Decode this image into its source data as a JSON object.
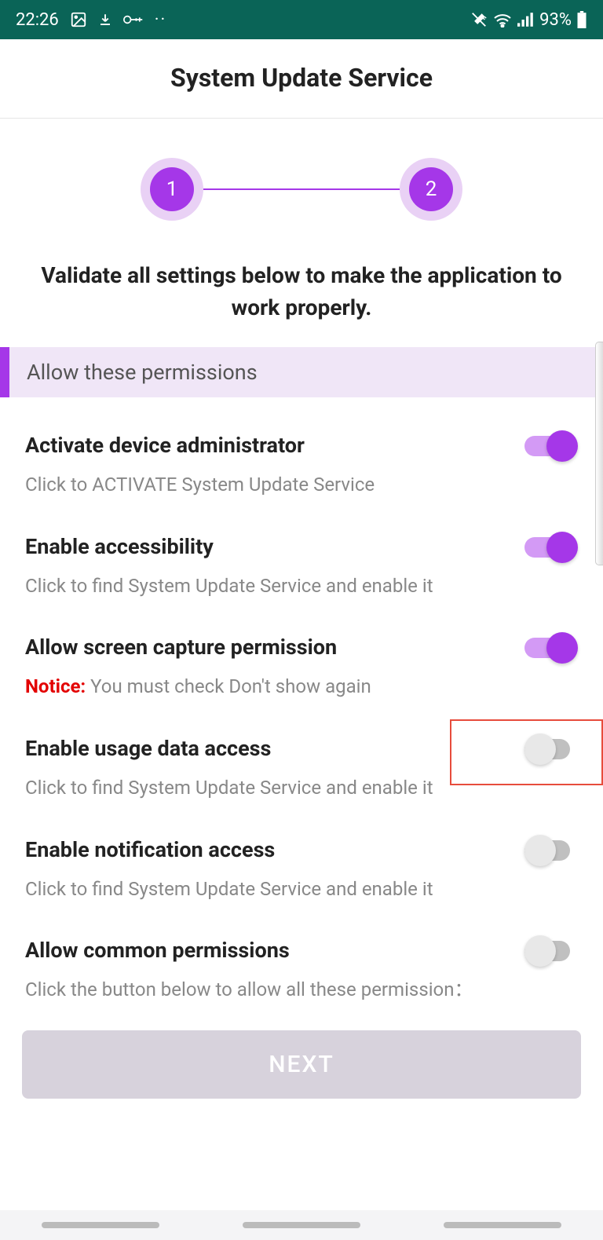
{
  "status": {
    "time": "22:26",
    "battery": "93%"
  },
  "header": {
    "title": "System Update Service"
  },
  "stepper": {
    "step1": "1",
    "step2": "2"
  },
  "instruction": "Validate all settings below to make the application to work properly.",
  "section_header": "Allow these permissions",
  "permissions": [
    {
      "title": "Activate device administrator",
      "desc": "Click to ACTIVATE System Update Service",
      "on": true,
      "highlight": false
    },
    {
      "title": "Enable accessibility",
      "desc": "Click to find System Update Service and enable it",
      "on": true,
      "highlight": false
    },
    {
      "title": "Allow screen capture permission",
      "notice": "Notice:",
      "desc": " You must check Don't show again",
      "on": true,
      "highlight": false
    },
    {
      "title": "Enable usage data access",
      "desc": "Click to find System Update Service and enable it",
      "on": false,
      "highlight": true
    },
    {
      "title": "Enable notification access",
      "desc": "Click to find System Update Service and enable it",
      "on": false,
      "highlight": false
    },
    {
      "title": "Allow common permissions",
      "desc": "Click the button below to allow all these permission：",
      "on": false,
      "highlight": false
    }
  ],
  "next_button": "NEXT"
}
